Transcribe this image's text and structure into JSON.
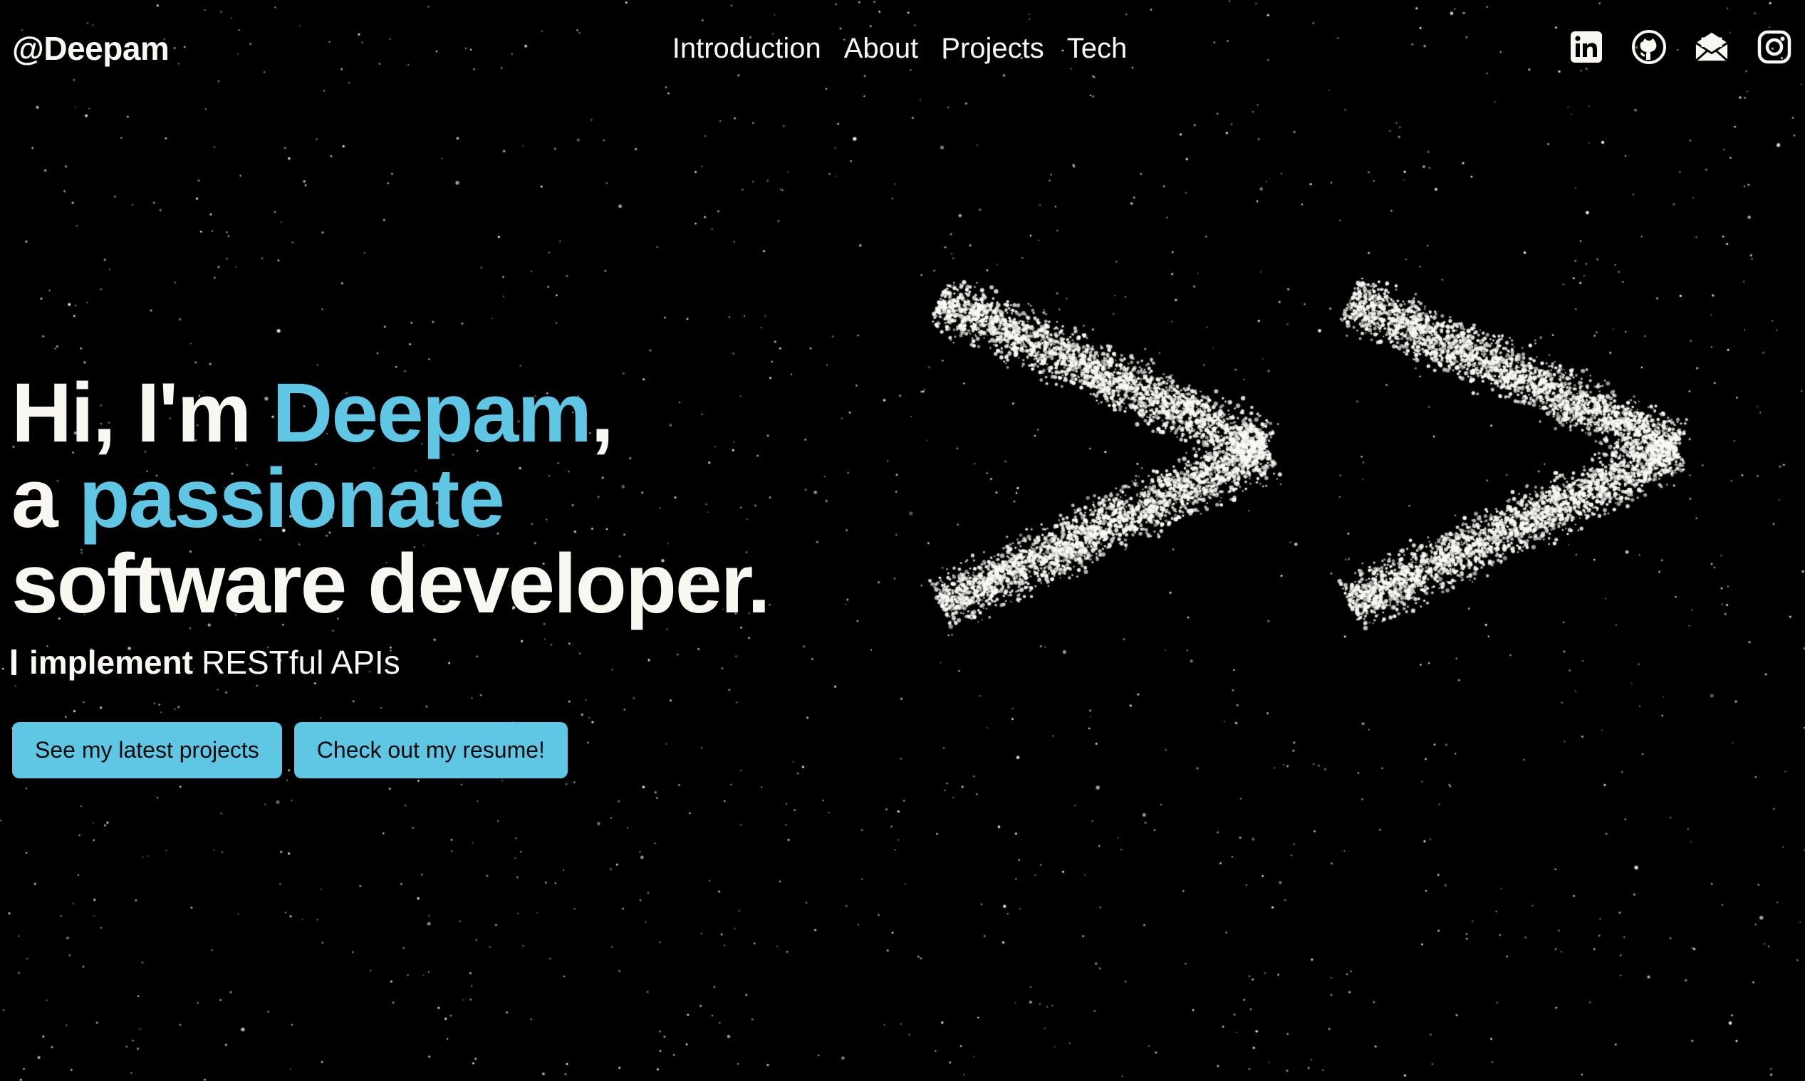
{
  "header": {
    "logo": "@Deepam",
    "nav": [
      "Introduction",
      "About",
      "Projects",
      "Tech"
    ],
    "socials": [
      {
        "name": "linkedin-icon"
      },
      {
        "name": "github-icon"
      },
      {
        "name": "mail-icon"
      },
      {
        "name": "instagram-icon"
      }
    ]
  },
  "hero": {
    "line1_prefix": "Hi, I'm ",
    "line1_accent": "Deepam",
    "line1_suffix": ",",
    "line2_prefix": "a ",
    "line2_accent": "passionate",
    "line3": "software developer.",
    "typed_verb": "implement",
    "typed_rest": "RESTful APIs",
    "typed_subject": "I"
  },
  "buttons": {
    "projects": "See my latest projects",
    "resume": "Check out my resume!"
  },
  "colors": {
    "background": "#000000",
    "text": "#f8f7f2",
    "accent": "#5fc6e3",
    "button_text": "#0b0b0b"
  },
  "graphic": {
    "name": "particle-double-chevron",
    "glyph": ">>"
  }
}
